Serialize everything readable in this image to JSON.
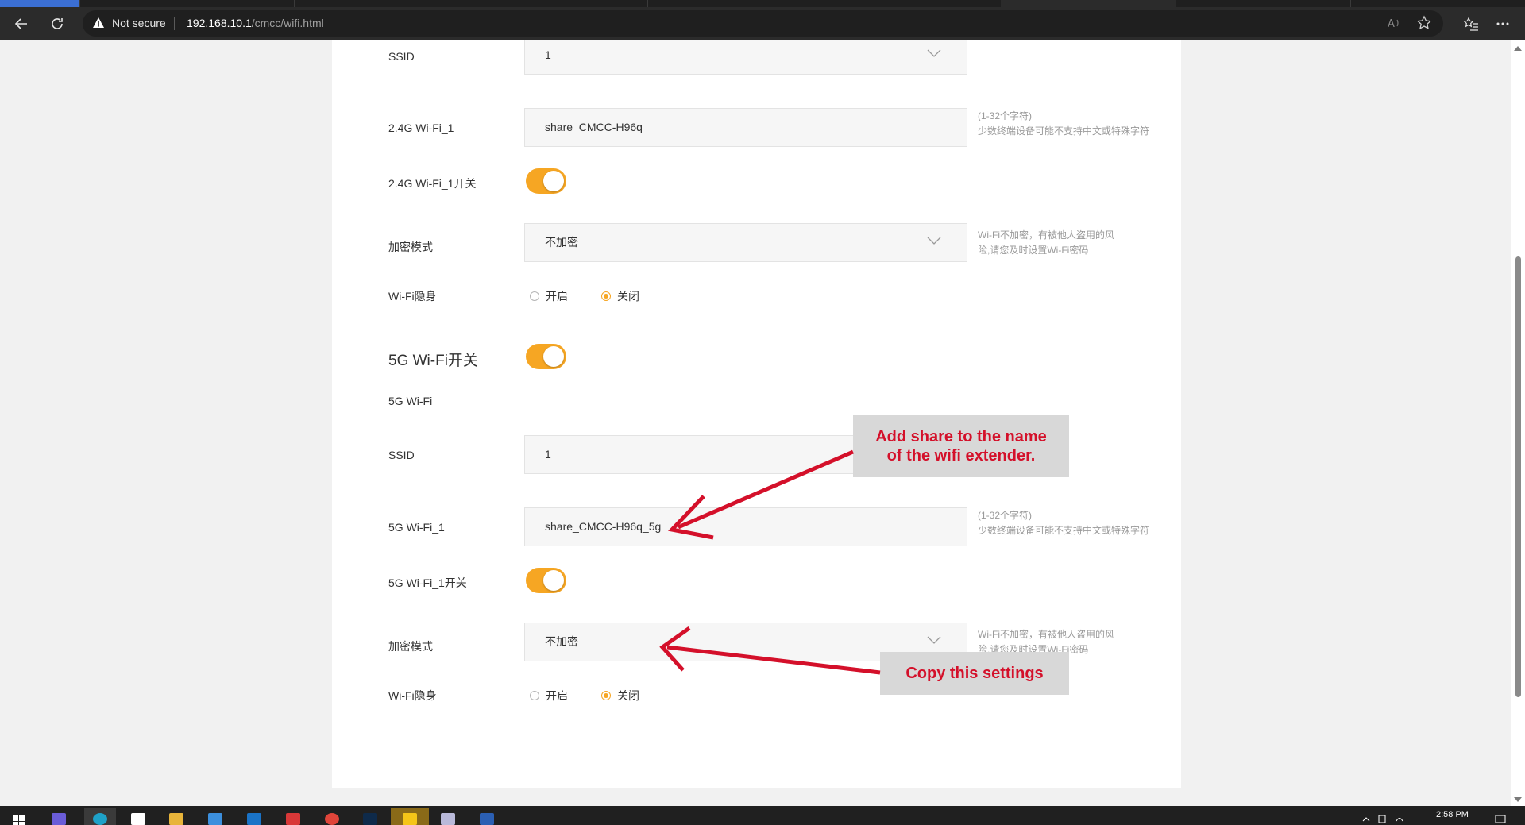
{
  "browser": {
    "not_secure_label": "Not secure",
    "url_host": "192.168.10.1",
    "url_path": "/cmcc/wifi.html"
  },
  "wifi24": {
    "ssid_label": "SSID",
    "ssid_value": "1",
    "name_label": "2.4G Wi-Fi_1",
    "name_value": "share_CMCC-H96q",
    "name_hint_1": "(1-32个字符)",
    "name_hint_2": "少数终端设备可能不支持中文或特殊字符",
    "switch_label": "2.4G Wi-Fi_1开关",
    "switch_on": true,
    "enc_label": "加密模式",
    "enc_value": "不加密",
    "enc_hint_1": "Wi-Fi不加密，有被他人盗用的风",
    "enc_hint_2": "险,请您及时设置Wi-Fi密码",
    "hidden_label": "Wi-Fi隐身",
    "hidden_on_label": "开启",
    "hidden_off_label": "关闭",
    "hidden_selected": "关闭"
  },
  "wifi5": {
    "master_label": "5G Wi-Fi开关",
    "master_on": true,
    "section_label": "5G Wi-Fi",
    "ssid_label": "SSID",
    "ssid_value": "1",
    "name_label": "5G Wi-Fi_1",
    "name_value": "share_CMCC-H96q_5g",
    "name_hint_1": "(1-32个字符)",
    "name_hint_2": "少数终端设备可能不支持中文或特殊字符",
    "switch_label": "5G Wi-Fi_1开关",
    "switch_on": true,
    "enc_label": "加密模式",
    "enc_value": "不加密",
    "enc_hint_1": "Wi-Fi不加密，有被他人盗用的风",
    "enc_hint_2": "险,请您及时设置Wi-Fi密码",
    "hidden_label": "Wi-Fi隐身",
    "hidden_on_label": "开启",
    "hidden_off_label": "关闭",
    "hidden_selected": "关闭"
  },
  "annotations": {
    "callout_1_line1": "Add share to the name",
    "callout_1_line2": "of the wifi extender.",
    "callout_2": "Copy this settings",
    "color": "#d4102a"
  },
  "taskbar": {
    "clock": "2:58 PM"
  },
  "colors": {
    "accent": "#f6a623"
  }
}
